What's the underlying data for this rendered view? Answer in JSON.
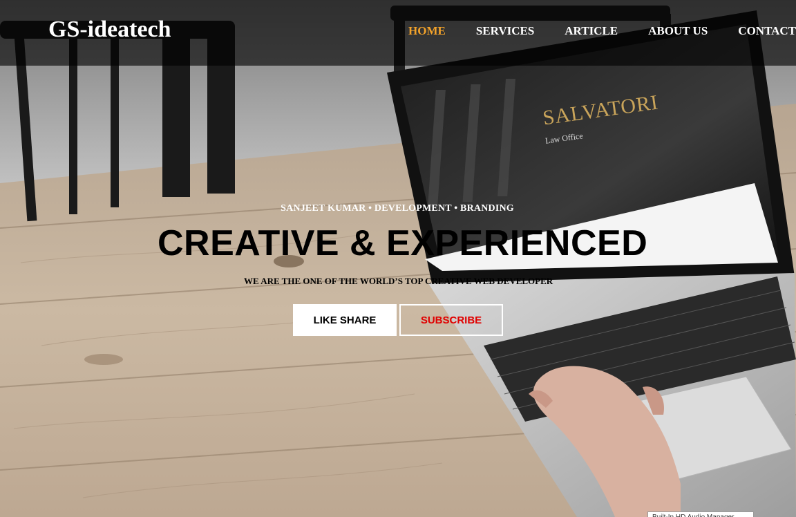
{
  "brand": {
    "name": "GS-ideatech"
  },
  "nav": {
    "items": [
      {
        "label": "HOME",
        "active": true
      },
      {
        "label": "SERVICES",
        "active": false
      },
      {
        "label": "ARTICLE",
        "active": false
      },
      {
        "label": "ABOUT US",
        "active": false
      },
      {
        "label": "CONTACT",
        "active": false
      }
    ]
  },
  "hero": {
    "tagline": "SANJEET KUMAR • DEVELOPMENT • BRANDING",
    "headline": "CREATIVE & EXPERIENCED",
    "subline": "WE ARE THE ONE OF THE WORLD’S TOP CREATIVE WEB DEVELOPER",
    "primary_button": "LIKE SHARE",
    "secondary_button": "SUBSCRIBE"
  },
  "laptop_screen": {
    "title": "SALVATORI",
    "subtitle": "Law Office"
  },
  "widget": {
    "label": "Built-In HD Audio Manager"
  },
  "colors": {
    "nav_active": "#f2a22a",
    "nav_text": "#ffffff",
    "subscribe_text": "#e00000",
    "topbar_bg": "rgba(0,0,0,0.62)"
  }
}
